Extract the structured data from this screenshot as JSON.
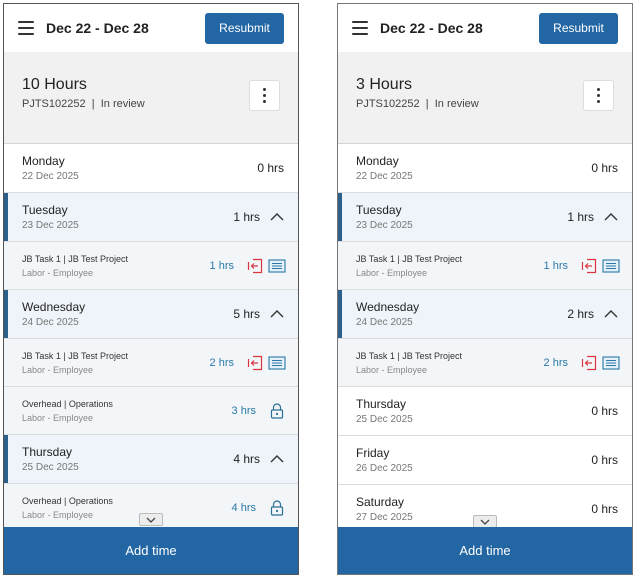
{
  "left": {
    "date_range": "Dec 22 - Dec 28",
    "resubmit_label": "Resubmit",
    "total_hours": "10 Hours",
    "timesheet_id": "PJTS102252",
    "separator": "|",
    "status": "In review",
    "days": [
      {
        "name": "Monday",
        "date": "22 Dec 2025",
        "hours": "0 hrs"
      },
      {
        "name": "Tuesday",
        "date": "23 Dec 2025",
        "hours": "1 hrs"
      },
      {
        "name": "Wednesday",
        "date": "24 Dec 2025",
        "hours": "5 hrs"
      },
      {
        "name": "Thursday",
        "date": "25 Dec 2025",
        "hours": "4 hrs"
      }
    ],
    "entries": [
      {
        "name": "JB Task 1 | JB Test Project",
        "type": "Labor - Employee",
        "hours": "1 hrs"
      },
      {
        "name": "JB Task 1 | JB Test Project",
        "type": "Labor - Employee",
        "hours": "2 hrs"
      },
      {
        "name": "Overhead | Operations",
        "type": "Labor - Employee",
        "hours": "3 hrs"
      },
      {
        "name": "Overhead | Operations",
        "type": "Labor - Employee",
        "hours": "4 hrs"
      }
    ],
    "add_time_label": "Add time"
  },
  "right": {
    "date_range": "Dec 22 - Dec 28",
    "resubmit_label": "Resubmit",
    "total_hours": "3 Hours",
    "timesheet_id": "PJTS102252",
    "separator": "|",
    "status": "In review",
    "days": [
      {
        "name": "Monday",
        "date": "22 Dec 2025",
        "hours": "0 hrs"
      },
      {
        "name": "Tuesday",
        "date": "23 Dec 2025",
        "hours": "1 hrs"
      },
      {
        "name": "Wednesday",
        "date": "24 Dec 2025",
        "hours": "2 hrs"
      },
      {
        "name": "Thursday",
        "date": "25 Dec 2025",
        "hours": "0 hrs"
      },
      {
        "name": "Friday",
        "date": "26 Dec 2025",
        "hours": "0 hrs"
      },
      {
        "name": "Saturday",
        "date": "27 Dec 2025",
        "hours": "0 hrs"
      }
    ],
    "entries": [
      {
        "name": "JB Task 1 | JB Test Project",
        "type": "Labor - Employee",
        "hours": "1 hrs"
      },
      {
        "name": "JB Task 1 | JB Test Project",
        "type": "Labor - Employee",
        "hours": "2 hrs"
      }
    ],
    "add_time_label": "Add time"
  },
  "colors": {
    "primary": "#2366a4",
    "accent_bar": "#2c5f8a",
    "hours_blue": "#2a78a6",
    "recall_red": "#d9363e",
    "summary_bg": "#f1f1f1"
  },
  "icons": [
    "menu-icon",
    "kebab-icon",
    "chevron-up-icon",
    "recall-icon",
    "details-icon",
    "lock-icon",
    "chevron-down-icon"
  ]
}
